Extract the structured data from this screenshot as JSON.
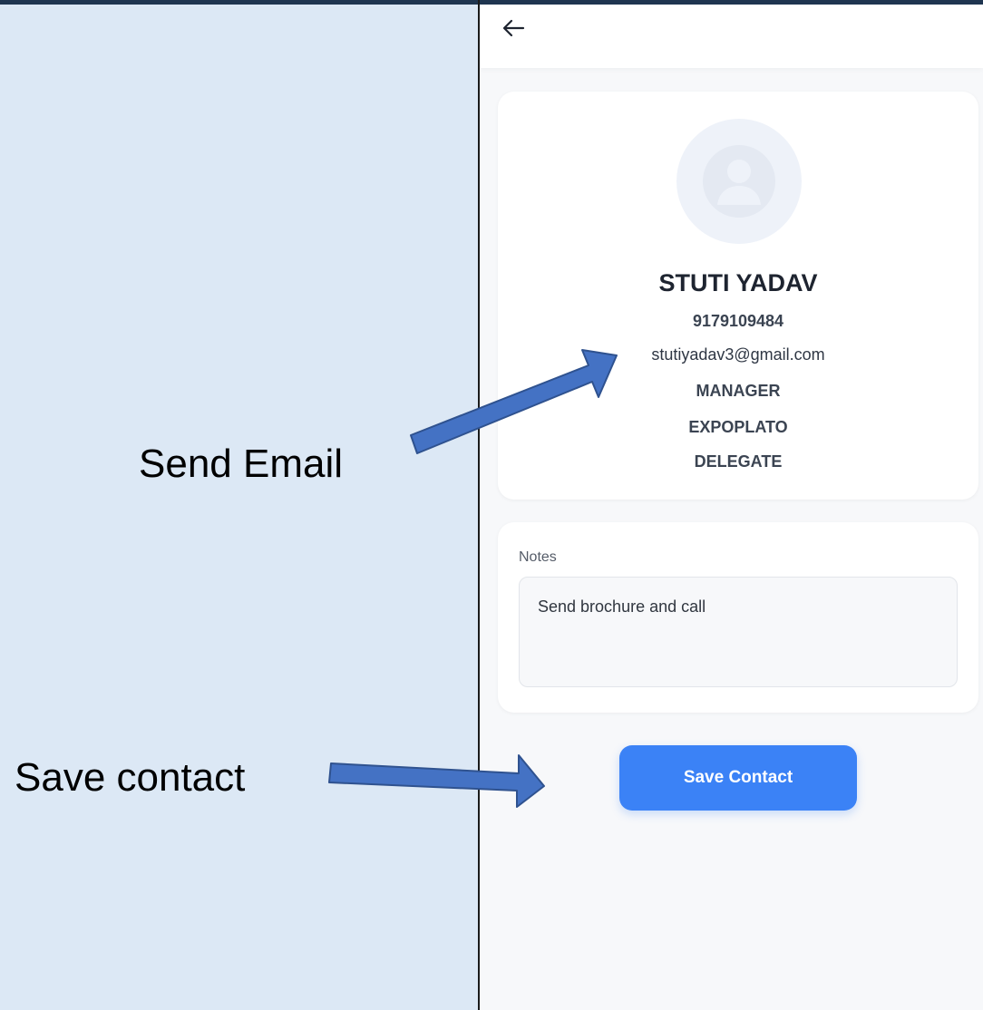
{
  "annotations": {
    "send_email": "Send Email",
    "save_contact": "Save contact"
  },
  "contact": {
    "name": "STUTI YADAV",
    "phone": "9179109484",
    "email": "stutiyadav3@gmail.com",
    "role": "MANAGER",
    "company": "EXPOPLATO",
    "category": "DELEGATE"
  },
  "notes": {
    "label": "Notes",
    "value": "Send brochure and call"
  },
  "actions": {
    "save_label": "Save Contact"
  },
  "icons": {
    "back": "arrow-left-icon",
    "avatar": "user-avatar-icon"
  },
  "colors": {
    "primary": "#3b82f6",
    "annotation_arrow": "#4472c4",
    "left_panel_bg": "#dce8f5"
  }
}
